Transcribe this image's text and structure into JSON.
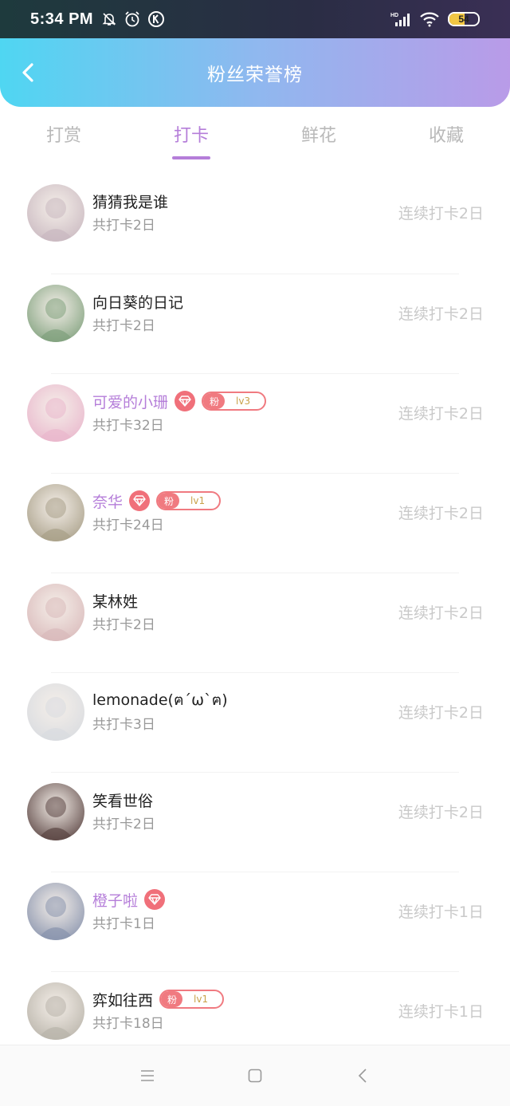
{
  "status_bar": {
    "time": "5:34 PM",
    "battery": "54",
    "battery_level": 0.54,
    "icons": [
      "mute-bell-icon",
      "alarm-icon",
      "k-app-icon",
      "signal-hd-icon",
      "wifi-icon",
      "battery-icon"
    ]
  },
  "header": {
    "title": "粉丝荣誉榜",
    "gradient": [
      "#4fd6f2",
      "#8fb8ef",
      "#b99be8"
    ]
  },
  "tabs": [
    {
      "label": "打赏",
      "active": false
    },
    {
      "label": "打卡",
      "active": true
    },
    {
      "label": "鲜花",
      "active": false
    },
    {
      "label": "收藏",
      "active": false
    }
  ],
  "accent_color": "#b57ed9",
  "rows": [
    {
      "name": "  猜猜我是谁",
      "total": "共打卡2日",
      "streak": "连续打卡2日",
      "vip": false,
      "diamond": false,
      "fan_level": null,
      "avatar_color": "#c9b8c0"
    },
    {
      "name": "向日葵的日记",
      "total": "共打卡2日",
      "streak": "连续打卡2日",
      "vip": false,
      "diamond": false,
      "fan_level": null,
      "avatar_color": "#7fa07c"
    },
    {
      "name": "可爱的小珊",
      "total": "共打卡32日",
      "streak": "连续打卡2日",
      "vip": true,
      "diamond": true,
      "fan_level": "lv3",
      "avatar_color": "#e9b6cc"
    },
    {
      "name": "奈华",
      "total": "共打卡24日",
      "streak": "连续打卡2日",
      "vip": true,
      "diamond": true,
      "fan_level": "lv1",
      "avatar_color": "#a89f88"
    },
    {
      "name": "某林姓",
      "total": "共打卡2日",
      "streak": "连续打卡2日",
      "vip": false,
      "diamond": false,
      "fan_level": null,
      "avatar_color": "#d9b9ba"
    },
    {
      "name": "lemonade(ฅ´ω`ฅ)",
      "total": "共打卡3日",
      "streak": "连续打卡2日",
      "vip": false,
      "diamond": false,
      "fan_level": null,
      "avatar_color": "#d8dbe0"
    },
    {
      "name": "笑看世俗",
      "total": "共打卡2日",
      "streak": "连续打卡2日",
      "vip": false,
      "diamond": false,
      "fan_level": null,
      "avatar_color": "#5a4442"
    },
    {
      "name": "橙子啦",
      "total": "共打卡1日",
      "streak": "连续打卡1日",
      "vip": true,
      "diamond": true,
      "fan_level": null,
      "avatar_color": "#8893ad"
    },
    {
      "name": "弈如往西",
      "total": "共打卡18日",
      "streak": "连续打卡1日",
      "vip": false,
      "diamond": false,
      "fan_level": "lv1",
      "avatar_color": "#b8b3a9"
    }
  ],
  "fan_badge_label": "粉",
  "nav": [
    "menu-icon",
    "home-icon",
    "back-icon"
  ]
}
